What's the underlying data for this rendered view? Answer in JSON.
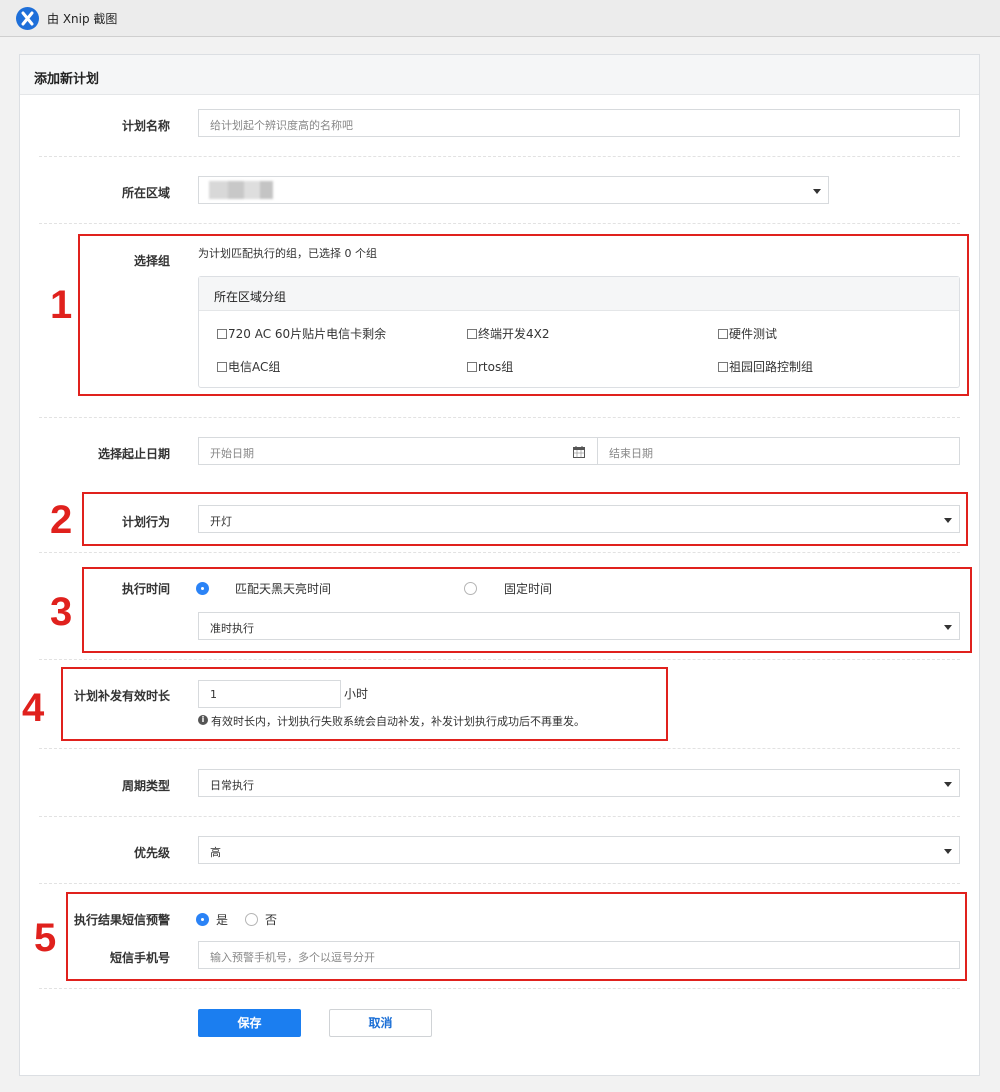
{
  "titlebar": {
    "app_title": "由 Xnip 截图"
  },
  "panel": {
    "title": "添加新计划"
  },
  "form": {
    "plan_name": {
      "label": "计划名称",
      "placeholder": "给计划起个辨识度高的名称吧"
    },
    "region": {
      "label": "所在区域",
      "value": ""
    },
    "group": {
      "label": "选择组",
      "hint": "为计划匹配执行的组，已选择 0 个组",
      "box_title": "所在区域分组",
      "options": [
        "720 AC 60片贴片电信卡剩余",
        "终端开发4X2",
        "硬件测试",
        "电信AC组",
        "rtos组",
        "祖园回路控制组"
      ]
    },
    "date_range": {
      "label": "选择起止日期",
      "start_placeholder": "开始日期",
      "end_placeholder": "结束日期"
    },
    "action": {
      "label": "计划行为",
      "value": "开灯"
    },
    "exec_time": {
      "label": "执行时间",
      "options": [
        "匹配天黑天亮时间",
        "固定时间"
      ],
      "selected": 0,
      "select_value": "准时执行"
    },
    "retry": {
      "label": "计划补发有效时长",
      "value": "1",
      "unit": "小时",
      "info": "有效时长内，计划执行失败系统会自动补发，补发计划执行成功后不再重发。"
    },
    "cycle": {
      "label": "周期类型",
      "value": "日常执行"
    },
    "priority": {
      "label": "优先级",
      "value": "高"
    },
    "sms_alert": {
      "label": "执行结果短信预警",
      "options": [
        "是",
        "否"
      ],
      "selected": 0
    },
    "sms_phone": {
      "label": "短信手机号",
      "placeholder": "输入预警手机号，多个以逗号分开"
    },
    "save_label": "保存",
    "cancel_label": "取消"
  },
  "annotations": [
    "1",
    "2",
    "3",
    "4",
    "5"
  ],
  "colors": {
    "primary": "#1b7ef0",
    "highlight": "#e0211d"
  }
}
